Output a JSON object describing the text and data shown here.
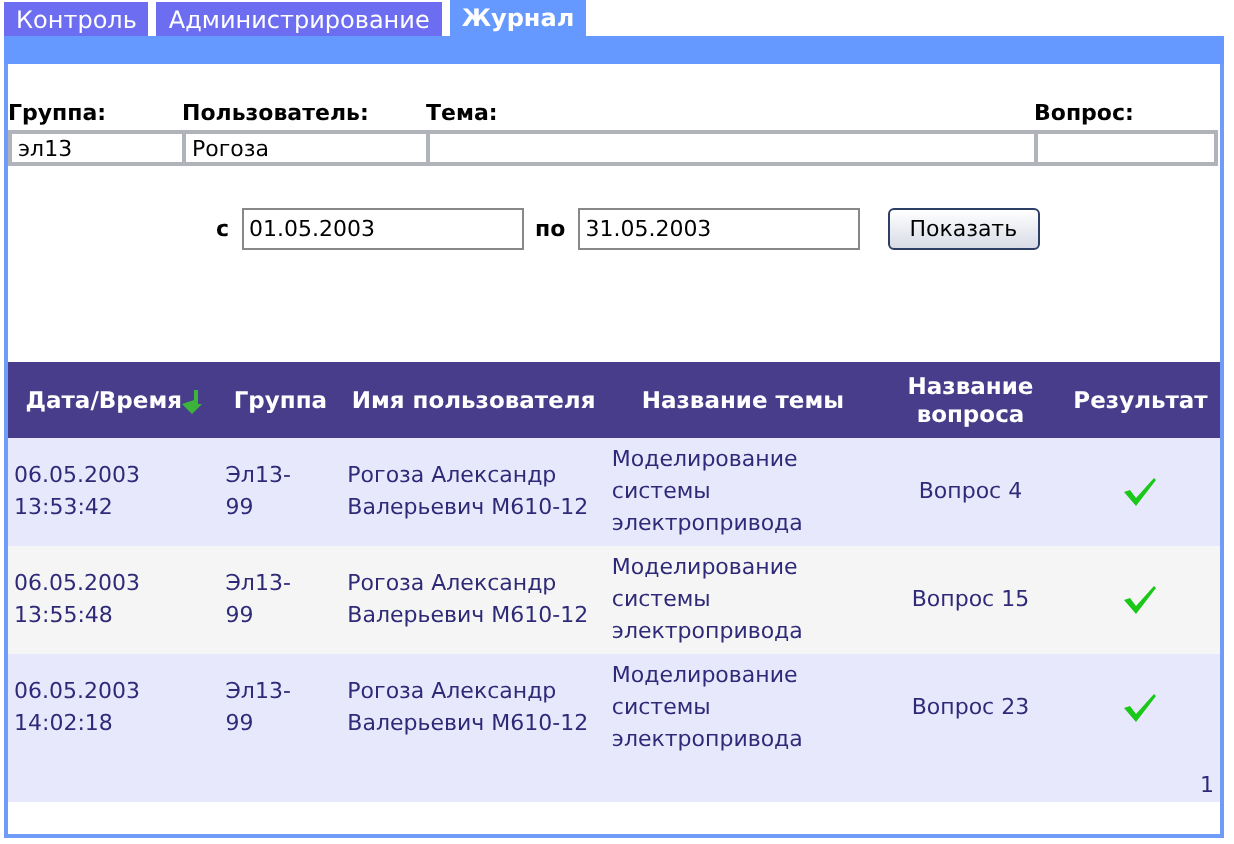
{
  "tabs": [
    {
      "label": "Контроль",
      "selected": false
    },
    {
      "label": "Администрирование",
      "selected": false
    },
    {
      "label": "Журнал",
      "selected": true
    }
  ],
  "filters": [
    {
      "label": "Группа:",
      "value": "эл13"
    },
    {
      "label": "Пользователь:",
      "value": "Рогоза"
    },
    {
      "label": "Тема:"
    },
    {
      "label": "Вопрос:"
    }
  ],
  "date_range": {
    "from_label": "с",
    "from": "01.05.2003",
    "to_label": "по",
    "to": "31.05.2003",
    "button": "Показать"
  },
  "table": {
    "columns": [
      {
        "label": "Дата/Время",
        "sorted": true
      },
      {
        "label": "Группа",
        "sorted": false
      },
      {
        "label": "Имя пользователя",
        "sorted": false
      },
      {
        "label": "Название темы",
        "sorted": false
      },
      {
        "label": "Название вопроса",
        "sorted": false
      },
      {
        "label": "Результат",
        "sorted": false
      }
    ],
    "rows": [
      {
        "datetime": [
          "06.05.2003",
          "13:53:42"
        ],
        "group": [
          "Эл13-",
          "99"
        ],
        "user": [
          "Рогоза Александр",
          "Валерьевич М610-12"
        ],
        "theme": [
          "Моделирование",
          "системы",
          "электропривода"
        ],
        "question": "Вопрос 4",
        "passed": true
      },
      {
        "datetime": [
          "06.05.2003",
          "13:55:48"
        ],
        "group": [
          "Эл13-",
          "99"
        ],
        "user": [
          "Рогоза Александр",
          "Валерьевич М610-12"
        ],
        "theme": [
          "Моделирование",
          "системы",
          "электропривода"
        ],
        "question": "Вопрос 15",
        "passed": true
      },
      {
        "datetime": [
          "06.05.2003",
          "14:02:18"
        ],
        "group": [
          "Эл13-",
          "99"
        ],
        "user": [
          "Рогоза Александр",
          "Валерьевич М610-12"
        ],
        "theme": [
          "Моделирование",
          "системы",
          "электропривода"
        ],
        "question": "Вопрос 23",
        "passed": true
      }
    ],
    "pager": "1"
  }
}
